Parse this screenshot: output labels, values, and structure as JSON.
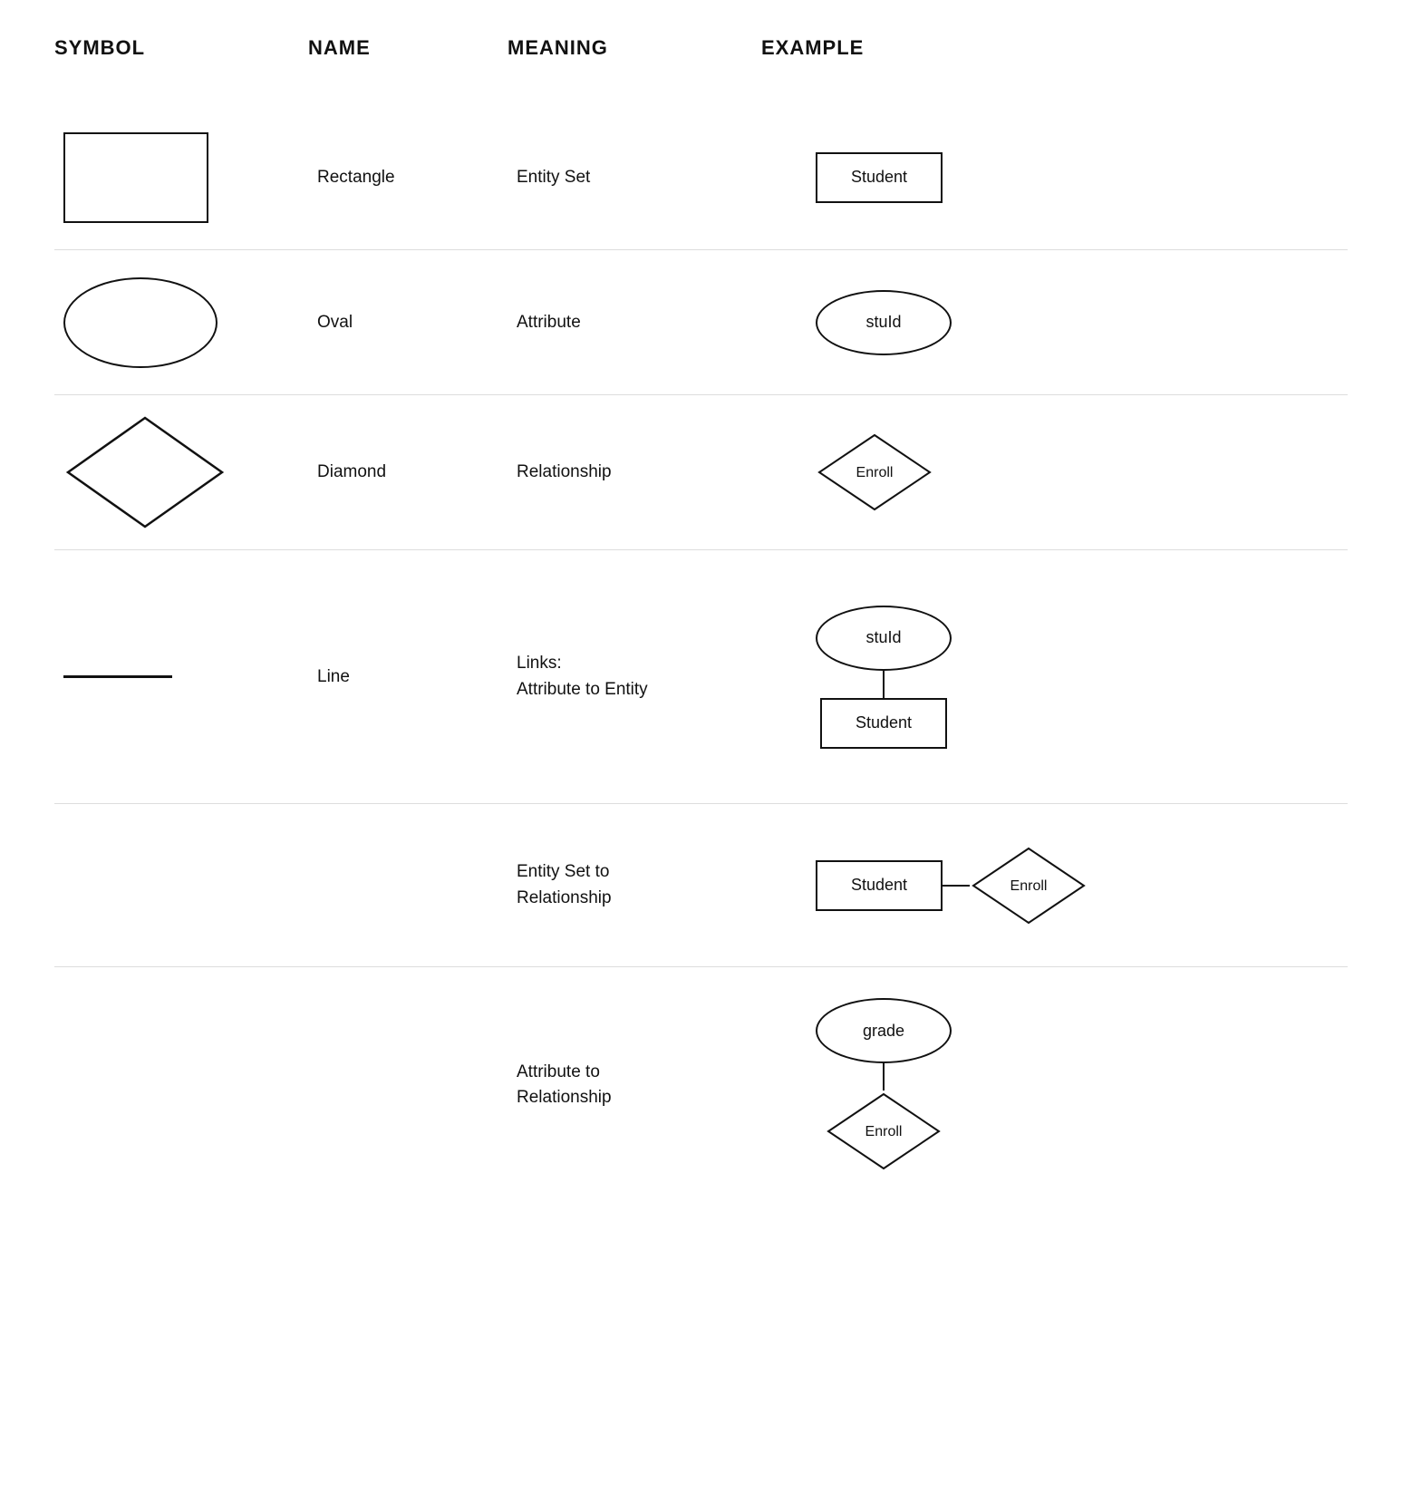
{
  "header": {
    "col1": "SYMBOL",
    "col2": "NAME",
    "col3": "MEANING",
    "col4": "EXAMPLE"
  },
  "rows": [
    {
      "id": "rectangle",
      "name": "Rectangle",
      "meaning": "Entity Set",
      "example_label": "Student",
      "type": "rect"
    },
    {
      "id": "oval",
      "name": "Oval",
      "meaning": "Attribute",
      "example_label": "stuId",
      "type": "oval"
    },
    {
      "id": "diamond",
      "name": "Diamond",
      "meaning": "Relationship",
      "example_label": "Enroll",
      "type": "diamond"
    },
    {
      "id": "line",
      "name": "Line",
      "meaning_line1": "Links:",
      "meaning_line2": "Attribute to Entity",
      "example_oval_label": "stuId",
      "example_rect_label": "Student",
      "type": "line"
    }
  ],
  "extra_rows": [
    {
      "id": "entity-set-to-rel",
      "meaning_line1": "Entity Set to",
      "meaning_line2": "Relationship",
      "rect_label": "Student",
      "diamond_label": "Enroll",
      "type": "entity-rel"
    },
    {
      "id": "attr-to-rel",
      "meaning_line1": "Attribute to",
      "meaning_line2": "Relationship",
      "oval_label": "grade",
      "diamond_label": "Enroll",
      "type": "attr-rel"
    }
  ]
}
